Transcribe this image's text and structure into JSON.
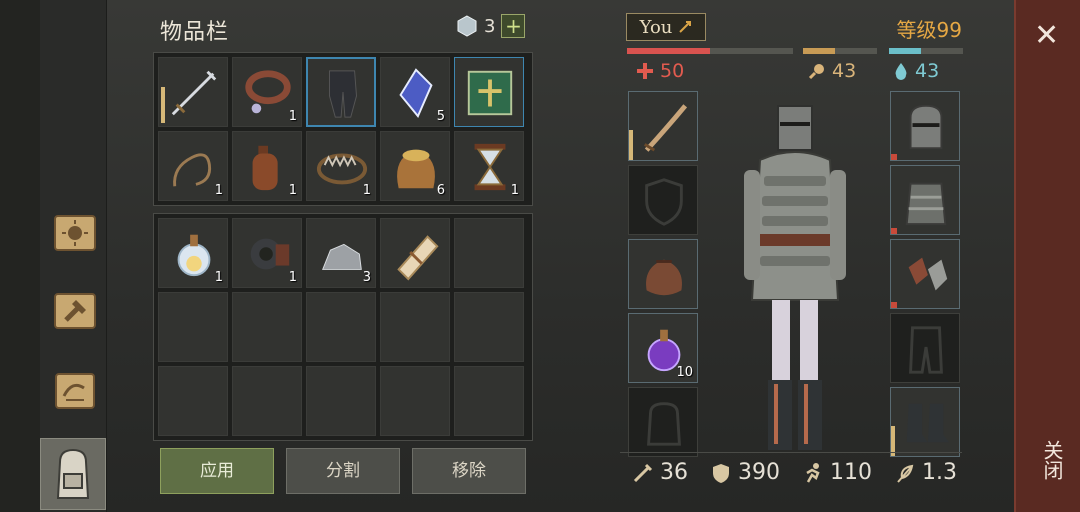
{
  "inventory": {
    "title": "物品栏",
    "gem_count": "3",
    "plus_label": "+",
    "buttons": {
      "apply": "应用",
      "split": "分割",
      "remove": "移除"
    },
    "top_slots": [
      {
        "item": "sword",
        "count": ""
      },
      {
        "item": "leather-collar",
        "count": "1"
      },
      {
        "item": "chainmail-leggings",
        "count": ""
      },
      {
        "item": "crystal",
        "count": "5"
      },
      {
        "item": "green-book",
        "count": ""
      },
      {
        "item": "rope",
        "count": "1"
      },
      {
        "item": "leather-flask",
        "count": "1"
      },
      {
        "item": "bear-trap",
        "count": "1"
      },
      {
        "item": "grain-sack",
        "count": "6"
      },
      {
        "item": "hourglass",
        "count": "1"
      }
    ],
    "bag_slots": [
      {
        "item": "light-potion",
        "count": "1"
      },
      {
        "item": "gear-part",
        "count": "1"
      },
      {
        "item": "stone-ore",
        "count": "3"
      },
      {
        "item": "scroll-bundle",
        "count": ""
      },
      {
        "item": "",
        "count": ""
      },
      {
        "item": "",
        "count": ""
      },
      {
        "item": "",
        "count": ""
      },
      {
        "item": "",
        "count": ""
      },
      {
        "item": "",
        "count": ""
      },
      {
        "item": "",
        "count": ""
      },
      {
        "item": "",
        "count": ""
      },
      {
        "item": "",
        "count": ""
      },
      {
        "item": "",
        "count": ""
      },
      {
        "item": "",
        "count": ""
      },
      {
        "item": "",
        "count": ""
      }
    ]
  },
  "character": {
    "name": "You",
    "level": "等级99",
    "health": "50",
    "food": "43",
    "water": "43",
    "left_slots": [
      {
        "item": "saber",
        "count": ""
      },
      {
        "item": "shield-empty",
        "count": ""
      },
      {
        "item": "pouch",
        "count": ""
      },
      {
        "item": "purple-potion",
        "count": "10"
      },
      {
        "item": "backpack-empty",
        "count": ""
      }
    ],
    "right_slots": [
      {
        "item": "great-helm"
      },
      {
        "item": "scale-armor"
      },
      {
        "item": "gauntlets"
      },
      {
        "item": "pants-empty"
      },
      {
        "item": "boots"
      }
    ],
    "bottom_stats": {
      "attack": "36",
      "armor": "390",
      "speed": "110",
      "weight": "1.3"
    }
  },
  "close": {
    "symbol": "✕",
    "label": "关闭"
  },
  "colors": {
    "accent": "#e6a844",
    "health": "#d9534f",
    "selection": "#3e86b0",
    "apply": "#5f6f45"
  }
}
